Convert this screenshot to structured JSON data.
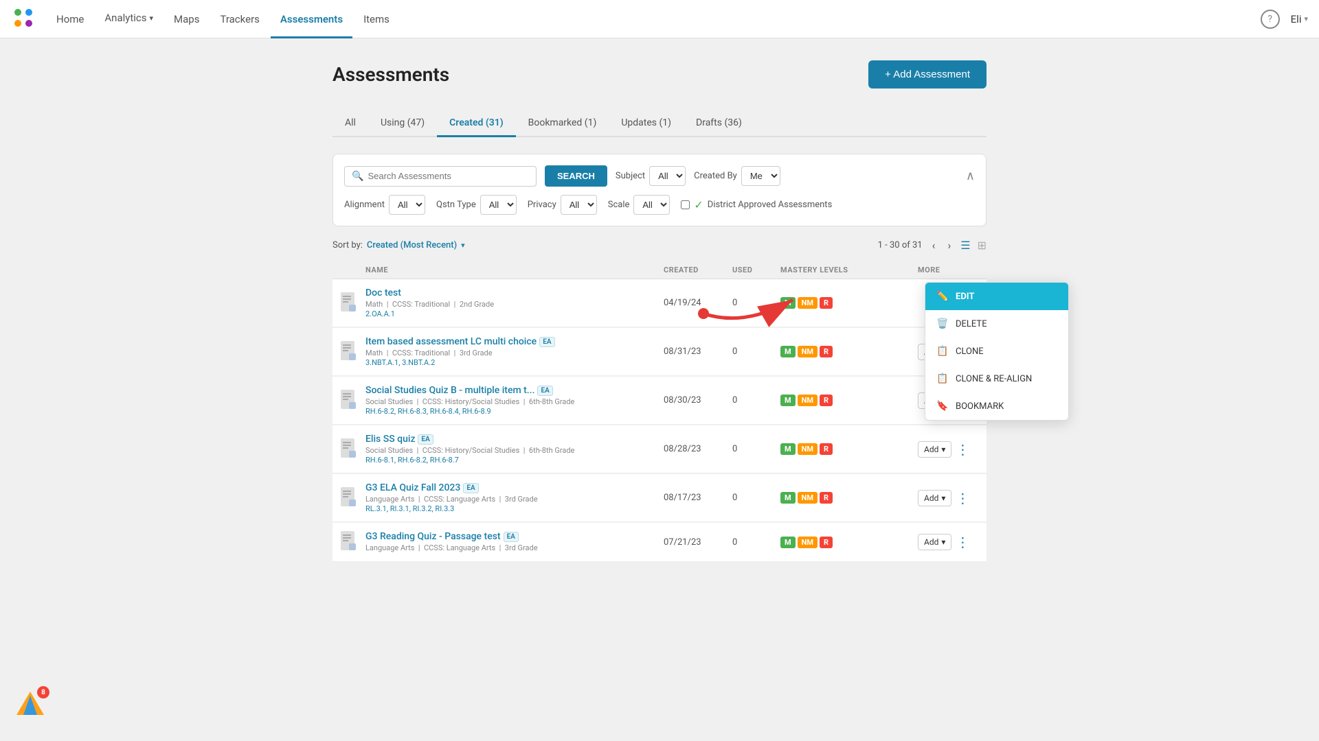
{
  "nav": {
    "links": [
      {
        "id": "home",
        "label": "Home",
        "active": false
      },
      {
        "id": "analytics",
        "label": "Analytics",
        "active": false,
        "hasDropdown": true
      },
      {
        "id": "maps",
        "label": "Maps",
        "active": false
      },
      {
        "id": "trackers",
        "label": "Trackers",
        "active": false
      },
      {
        "id": "assessments",
        "label": "Assessments",
        "active": true
      },
      {
        "id": "items",
        "label": "Items",
        "active": false
      }
    ],
    "user": "Eli",
    "notif_count": "8"
  },
  "page": {
    "title": "Assessments",
    "add_button": "+ Add Assessment"
  },
  "tabs": [
    {
      "id": "all",
      "label": "All",
      "active": false
    },
    {
      "id": "using",
      "label": "Using (47)",
      "active": false
    },
    {
      "id": "created",
      "label": "Created (31)",
      "active": true
    },
    {
      "id": "bookmarked",
      "label": "Bookmarked (1)",
      "active": false
    },
    {
      "id": "updates",
      "label": "Updates (1)",
      "active": false
    },
    {
      "id": "drafts",
      "label": "Drafts (36)",
      "active": false
    }
  ],
  "search": {
    "placeholder": "Search Assessments",
    "button": "SEARCH",
    "subject_label": "Subject",
    "subject_value": "All",
    "created_by_label": "Created By",
    "created_by_value": "Me",
    "alignment_label": "Alignment",
    "alignment_value": "All",
    "qstn_type_label": "Qstn Type",
    "qstn_type_value": "All",
    "privacy_label": "Privacy",
    "privacy_value": "All",
    "scale_label": "Scale",
    "scale_value": "All",
    "district_label": "District Approved Assessments"
  },
  "sort": {
    "label": "Sort by:",
    "value": "Created (Most Recent)",
    "pagination": "1 - 30 of 31"
  },
  "table": {
    "headers": [
      "",
      "NAME",
      "CREATED",
      "USED",
      "MASTERY LEVELS",
      "MORE"
    ],
    "rows": [
      {
        "id": "row1",
        "name": "Doc test",
        "subject": "Math",
        "framework": "CCSS: Traditional",
        "grade": "2nd Grade",
        "standards": "2.OA.A.1",
        "created": "04/19/24",
        "used": "0",
        "mastery": [
          "M",
          "NM",
          "R"
        ],
        "show_menu": true
      },
      {
        "id": "row2",
        "name": "Item based assessment LC multi choice",
        "subject": "Math",
        "framework": "CCSS: Traditional",
        "grade": "3rd Grade",
        "standards": "3.NBT.A.1, 3.NBT.A.2",
        "created": "08/31/23",
        "used": "0",
        "mastery": [
          "M",
          "NM",
          "R"
        ],
        "ea": true
      },
      {
        "id": "row3",
        "name": "Social Studies Quiz B - multiple item t...",
        "subject": "Social Studies",
        "framework": "CCSS: History/Social Studies",
        "grade": "6th-8th Grade",
        "standards": "RH.6-8.2, RH.6-8.3, RH.6-8.4, RH.6-8.9",
        "created": "08/30/23",
        "used": "0",
        "mastery": [
          "M",
          "NM",
          "R"
        ],
        "ea": true
      },
      {
        "id": "row4",
        "name": "Elis SS quiz",
        "subject": "Social Studies",
        "framework": "CCSS: History/Social Studies",
        "grade": "6th-8th Grade",
        "standards": "RH.6-8.1, RH.6-8.2, RH.6-8.7",
        "created": "08/28/23",
        "used": "0",
        "mastery": [
          "M",
          "NM",
          "R"
        ],
        "ea": true
      },
      {
        "id": "row5",
        "name": "G3 ELA Quiz Fall 2023",
        "subject": "Language Arts",
        "framework": "CCSS: Language Arts",
        "grade": "3rd Grade",
        "standards": "RL.3.1, RI.3.1, RI.3.2, RI.3.3",
        "created": "08/17/23",
        "used": "0",
        "mastery": [
          "M",
          "NM",
          "R"
        ],
        "ea": true
      },
      {
        "id": "row6",
        "name": "G3 Reading Quiz - Passage test",
        "subject": "Language Arts",
        "framework": "CCSS: Language Arts",
        "grade": "3rd Grade",
        "standards": "",
        "created": "07/21/23",
        "used": "0",
        "mastery": [
          "M",
          "NM",
          "R"
        ],
        "ea": true
      }
    ]
  },
  "context_menu": {
    "items": [
      {
        "id": "edit",
        "label": "EDIT",
        "active": true,
        "icon": "edit-icon"
      },
      {
        "id": "delete",
        "label": "DELETE",
        "active": false,
        "icon": "trash-icon"
      },
      {
        "id": "clone",
        "label": "CLONE",
        "active": false,
        "icon": "clone-icon"
      },
      {
        "id": "clone-realign",
        "label": "CLONE & RE-ALIGN",
        "active": false,
        "icon": "clone-realign-icon"
      },
      {
        "id": "bookmark",
        "label": "BOOKMARK",
        "active": false,
        "icon": "bookmark-icon"
      }
    ]
  }
}
